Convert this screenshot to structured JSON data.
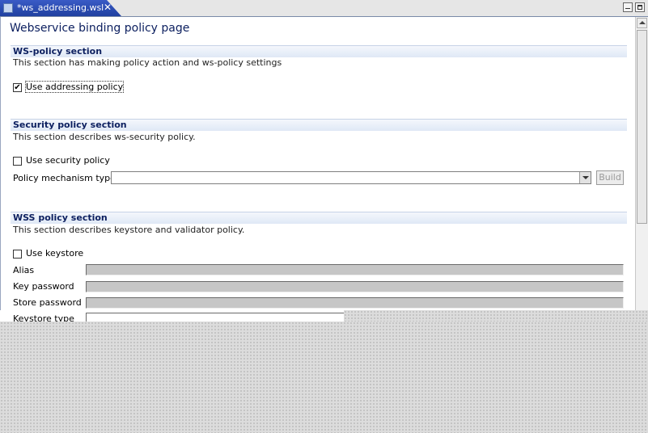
{
  "tab": {
    "title": "*ws_addressing.wsl",
    "close_glyph": "✕"
  },
  "window_controls": {
    "minimize": "minimize",
    "maximize": "maximize"
  },
  "page": {
    "title": "Webservice binding policy page"
  },
  "ws_policy": {
    "header": "WS-policy section",
    "description": "This section has making policy action and ws-policy settings",
    "use_addressing_label": "Use addressing policy",
    "use_addressing_checked": true
  },
  "security_policy": {
    "header": "Security policy section",
    "description": "This section describes ws-security policy.",
    "use_security_label": "Use security policy",
    "use_security_checked": false,
    "mechanism_label": "Policy mechanism type",
    "mechanism_value": "",
    "build_label": "Build"
  },
  "wss_policy": {
    "header": "WSS policy section",
    "description": "This section describes keystore and validator policy.",
    "use_keystore_label": "Use keystore",
    "use_keystore_checked": false,
    "fields": [
      {
        "label": "Alias",
        "value": ""
      },
      {
        "label": "Key password",
        "value": ""
      },
      {
        "label": "Store password",
        "value": ""
      },
      {
        "label": "Keystore type",
        "value": ""
      }
    ]
  },
  "icons": {
    "file": "file-icon",
    "close": "close-icon",
    "dropdown": "chevron-down-icon",
    "check": "checkmark-icon"
  }
}
